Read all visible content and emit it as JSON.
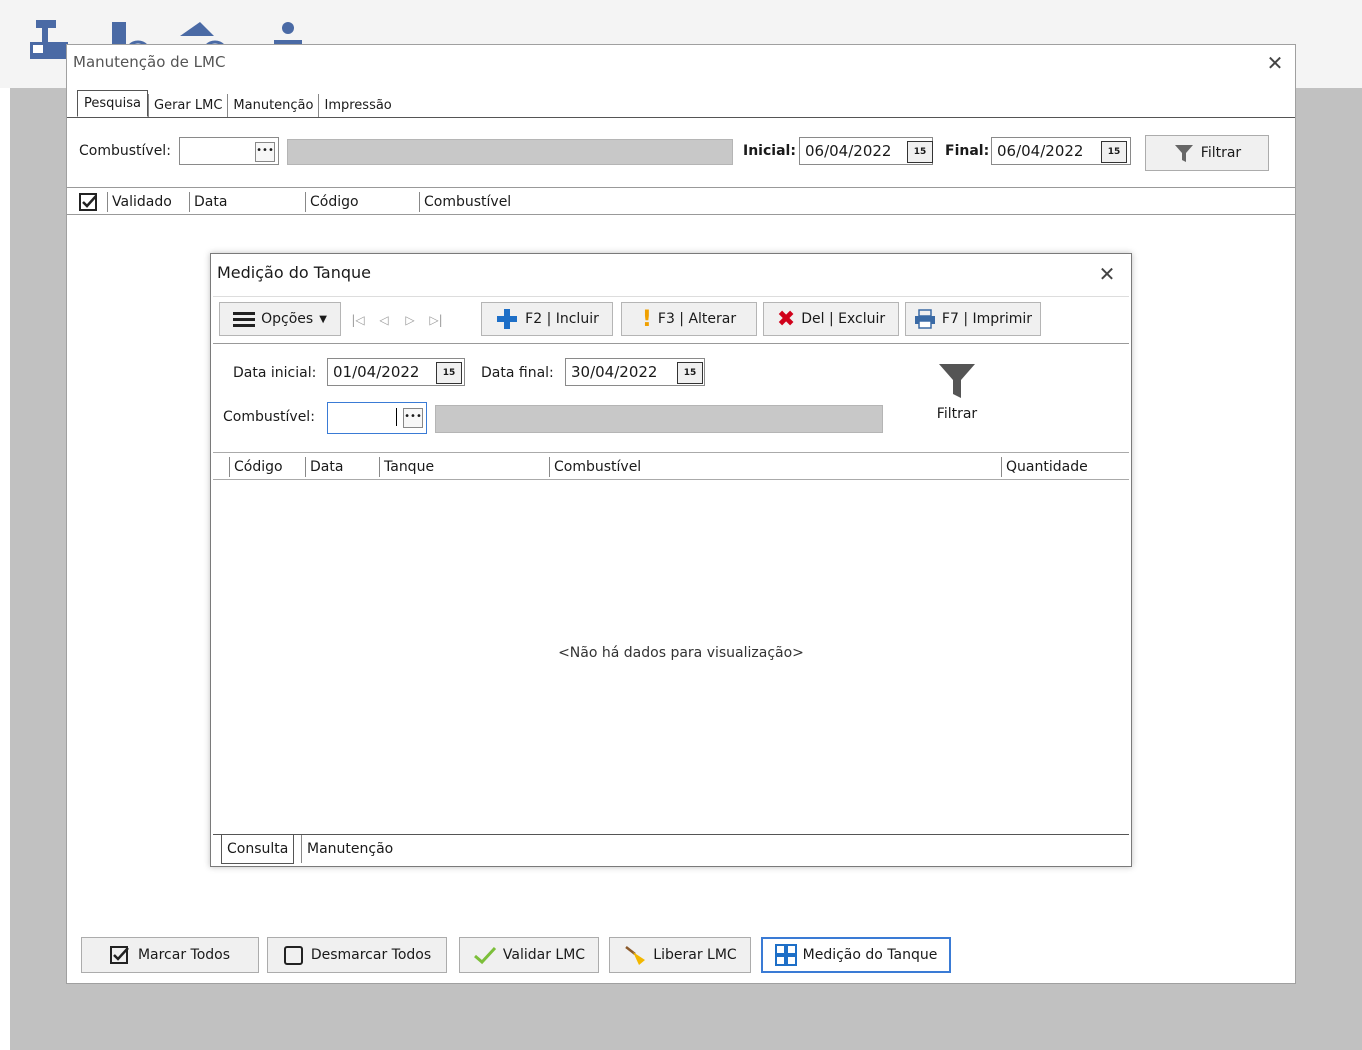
{
  "main_window": {
    "title": "Manutenção de LMC",
    "tabs": [
      "Pesquisa",
      "Gerar LMC",
      "Manutenção",
      "Impressão"
    ],
    "search": {
      "fuel_label": "Combustível:",
      "fuel_value": "",
      "initial_label": "Inicial:",
      "initial_date": "06/04/2022",
      "final_label": "Final:",
      "final_date": "06/04/2022",
      "filter_label": "Filtrar"
    },
    "grid_columns": [
      "Validado",
      "Data",
      "Código",
      "Combustível"
    ],
    "bottom_buttons": [
      "Marcar Todos",
      "Desmarcar Todos",
      "Validar LMC",
      "Liberar LMC",
      "Medição do Tanque"
    ]
  },
  "modal": {
    "title": "Medição do Tanque",
    "toolbar": {
      "options_label": "Opções",
      "include_label": "F2 | Incluir",
      "alter_label": "F3 | Alterar",
      "delete_label": "Del | Excluir",
      "print_label": "F7 | Imprimir"
    },
    "filters": {
      "start_label": "Data inicial:",
      "start_date": "01/04/2022",
      "end_label": "Data final:",
      "end_date": "30/04/2022",
      "fuel_label": "Combustível:",
      "fuel_value": "",
      "filter_label": "Filtrar"
    },
    "grid_columns": [
      "Código",
      "Data",
      "Tanque",
      "Combustível",
      "Quantidade"
    ],
    "empty_message": "<Não há dados para visualização>",
    "bottom_tabs": [
      "Consulta",
      "Manutenção"
    ]
  },
  "icons": [
    "cash-register-icon",
    "flag-icon",
    "flag-icon",
    "user-icon",
    "close-icon",
    "calendar-icon",
    "filter-icon",
    "checkbox-icon",
    "plus-icon",
    "exclamation-icon",
    "x-icon",
    "printer-icon",
    "hamburger-icon",
    "broom-icon",
    "checkmark-icon",
    "grid-icon"
  ],
  "colors": {
    "accent": "#3a7bd5",
    "plus": "#1e6fc7",
    "delete": "#d0021b",
    "exclamation": "#f0a000"
  }
}
